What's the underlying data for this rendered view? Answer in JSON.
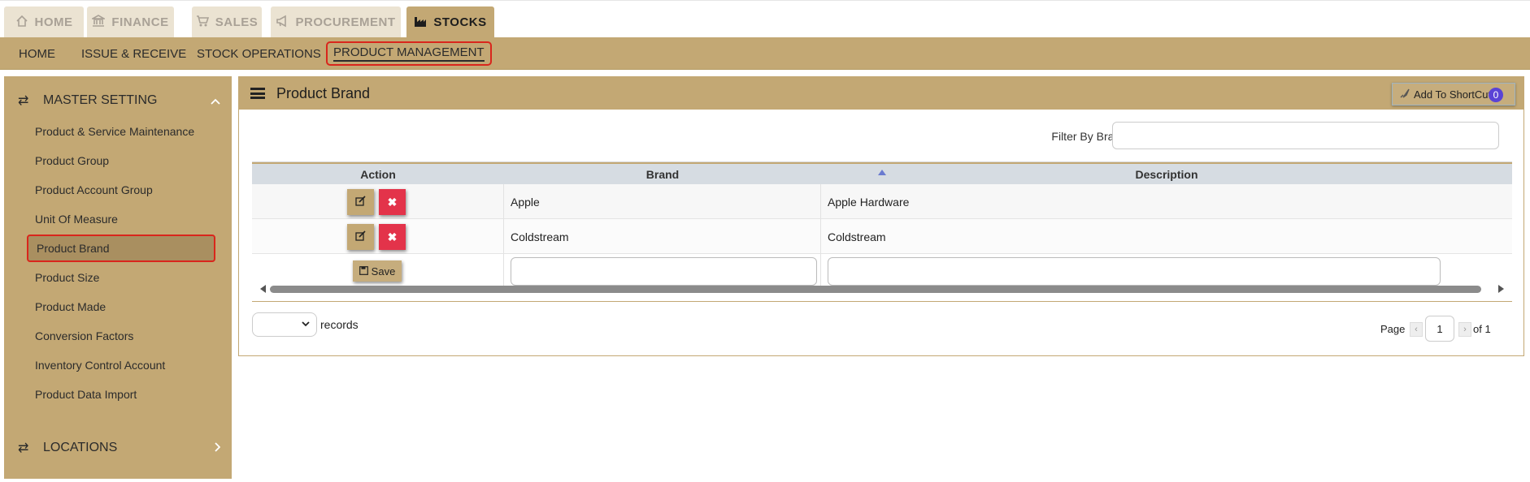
{
  "top_tabs": [
    {
      "label": "HOME",
      "icon": "home-icon"
    },
    {
      "label": "FINANCE",
      "icon": "bank-icon"
    },
    {
      "label": "SALES",
      "icon": "cart-icon"
    },
    {
      "label": "PROCUREMENT",
      "icon": "bullhorn-icon"
    },
    {
      "label": "STOCKS",
      "icon": "factory-icon",
      "active": true
    }
  ],
  "subnav": [
    {
      "label": "HOME"
    },
    {
      "label": "ISSUE & RECEIVE"
    },
    {
      "label": "STOCK OPERATIONS"
    },
    {
      "label": "PRODUCT MANAGEMENT",
      "active": true
    }
  ],
  "sidebar": {
    "sections": [
      {
        "label": "MASTER SETTING",
        "icon": "swap-icon",
        "chevron": "chevron-up-icon"
      },
      {
        "label": "LOCATIONS",
        "icon": "swap-icon",
        "chevron": "chevron-right-icon"
      }
    ],
    "items": [
      {
        "label": "Product & Service Maintenance"
      },
      {
        "label": "Product Group"
      },
      {
        "label": "Product Account Group"
      },
      {
        "label": "Unit Of Measure"
      },
      {
        "label": "Product Brand",
        "active": true
      },
      {
        "label": "Product Size"
      },
      {
        "label": "Product Made"
      },
      {
        "label": "Conversion Factors"
      },
      {
        "label": "Inventory Control Account"
      },
      {
        "label": "Product Data Import"
      }
    ]
  },
  "panel": {
    "title": "Product Brand",
    "shortcut_label": "Add To ShortCut",
    "shortcut_count": "0",
    "filter_label": "Filter By Brand",
    "filter_value": ""
  },
  "grid": {
    "columns": [
      "Action",
      "Brand",
      "Description"
    ],
    "sorted_column": "Brand",
    "sort_direction": "ascending",
    "rows": [
      {
        "brand": "Apple",
        "description": "Apple Hardware"
      },
      {
        "brand": "Coldstream",
        "description": "Coldstream"
      }
    ],
    "new_row": {
      "save_label": "Save",
      "brand": "",
      "description": ""
    }
  },
  "footer": {
    "records_label": "records",
    "page_label": "Page",
    "page_current": "1",
    "page_of": "of 1"
  },
  "colors": {
    "accent": "#c3a874",
    "highlight_border": "#d9261c",
    "delete_button": "#e3334a",
    "badge": "#5a43d6"
  }
}
